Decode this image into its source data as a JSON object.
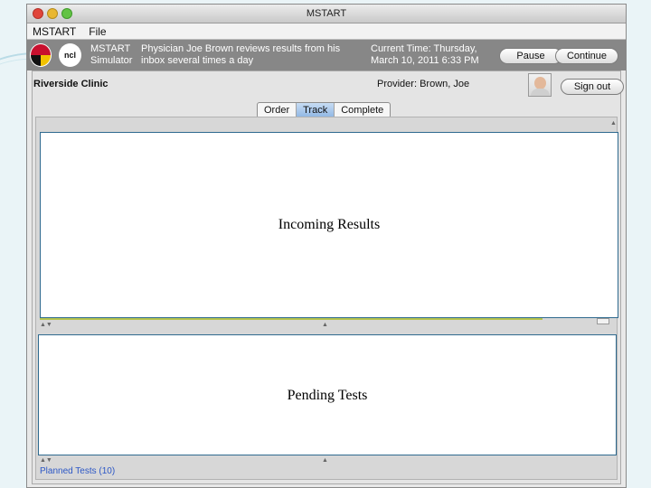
{
  "window": {
    "title": "MSTART"
  },
  "menubar": {
    "items": [
      "MSTART",
      "File"
    ]
  },
  "infobar": {
    "logo1": "maryland-flag-icon",
    "logo2_text": "ncl",
    "sim_name_line1": "MSTART",
    "sim_name_line2": "Simulator",
    "description_line1": "Physician Joe Brown reviews results from his",
    "description_line2": "inbox several times a day",
    "clock_line1": "Current Time: Thursday,",
    "clock_line2": "March 10, 2011 6:33 PM",
    "pause_label": "Pause",
    "continue_label": "Continue"
  },
  "header": {
    "clinic": "Riverside Clinic",
    "provider": "Provider: Brown, Joe",
    "signout_label": "Sign out"
  },
  "tabs": [
    {
      "label": "Order",
      "active": false
    },
    {
      "label": "Track",
      "active": true
    },
    {
      "label": "Complete",
      "active": false
    }
  ],
  "panels": {
    "incoming_label": "Incoming Results",
    "pending_label": "Pending Tests"
  },
  "footer": {
    "planned_tests": "Planned Tests (10)"
  },
  "colors": {
    "active_tab": "#9dbfe8",
    "panel_border": "#2f6a8f",
    "link": "#2c57c6"
  }
}
